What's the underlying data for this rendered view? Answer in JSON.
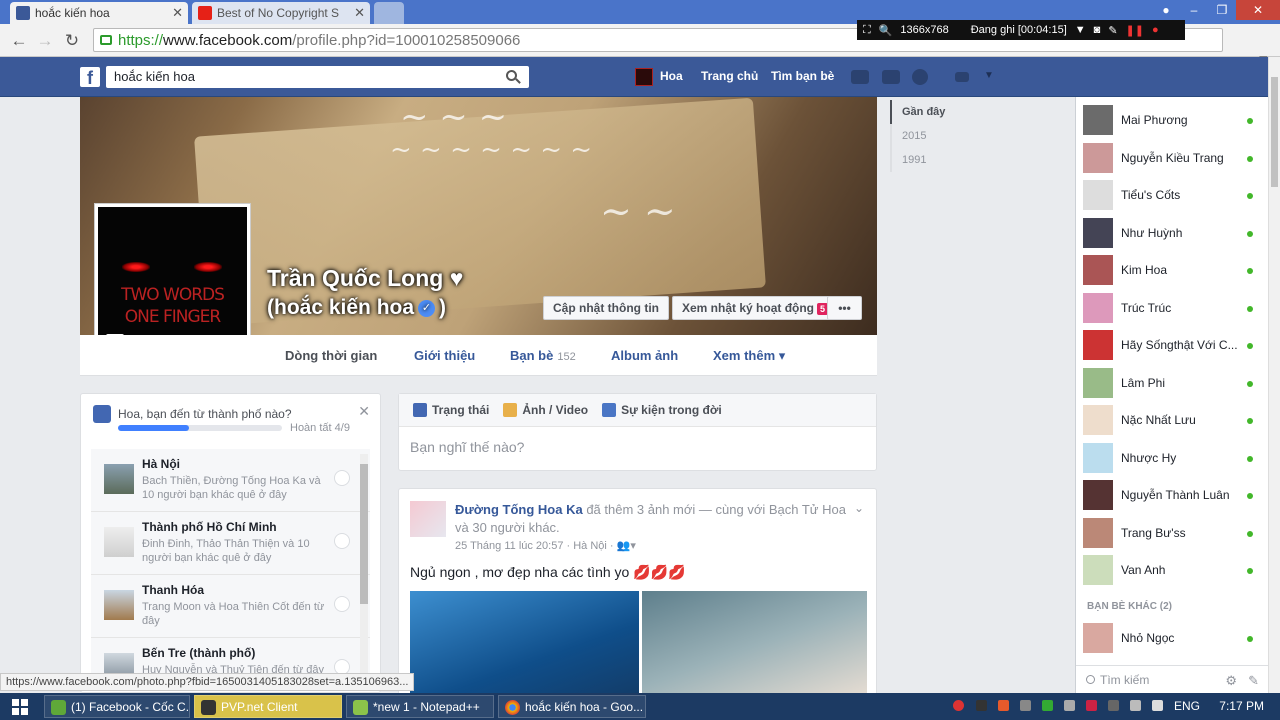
{
  "browser": {
    "tabs": [
      {
        "title": "hoắc kiến hoa",
        "favicon": "facebook-icon",
        "active": true
      },
      {
        "title": "Best of No Copyright S",
        "favicon": "youtube-icon",
        "active": false
      }
    ],
    "url_scheme": "https://",
    "url_host": "www.facebook.com",
    "url_path": "/profile.php?id=100010258509066",
    "recorder": {
      "resolution": "1366x768",
      "status": "Đang ghi [00:04:15]"
    }
  },
  "fb_header": {
    "search_value": "hoắc kiến hoa",
    "user_name": "Hoa",
    "home": "Trang chủ",
    "find_friends": "Tìm bạn bè"
  },
  "profile": {
    "name": "Trần Quốc Long ♥",
    "alt_name": "(hoắc kiến hoa",
    "alt_name_suffix": ")",
    "picture_text_1": "TWO WORDS",
    "picture_text_2": "ONE FINGER",
    "update_info": "Cập nhật thông tin",
    "activity_log": "Xem nhật ký hoạt động",
    "activity_badge": "5",
    "more_dots": "•••"
  },
  "profile_tabs": [
    {
      "label": "Dòng thời gian"
    },
    {
      "label": "Giới thiệu"
    },
    {
      "label": "Bạn bè",
      "count": "152"
    },
    {
      "label": "Album ảnh"
    },
    {
      "label": "Xem thêm ▾"
    }
  ],
  "hometown": {
    "question": "Hoa, bạn đến từ thành phố nào?",
    "progress": 0.43,
    "done": "Hoàn tất 4/9",
    "cities": [
      {
        "name": "Hà Nội",
        "desc": "Bach Thiền, Đường Tống Hoa Ka và 10 người bạn khác quê ở đây"
      },
      {
        "name": "Thành phố Hồ Chí Minh",
        "desc": "Đinh Đinh, Thảo Thản Thiện và 10 người bạn khác quê ở đây"
      },
      {
        "name": "Thanh Hóa",
        "desc": "Trang Moon và Hoa Thiên Cốt đến từ đây"
      },
      {
        "name": "Bến Tre (thành phố)",
        "desc": "Huy Nguyễn và Thuỷ Tiên đến từ đây"
      }
    ]
  },
  "composer": {
    "status": "Trạng thái",
    "photo": "Ảnh / Video",
    "life_event": "Sự kiện trong đời",
    "placeholder": "Bạn nghĩ thế nào?"
  },
  "post": {
    "author": "Đường Tống Hoa Ka",
    "action": "đã thêm 3 ảnh mới — cùng với Bạch Tử Hoa và 30 người khác.",
    "meta": "25 Tháng 11 lúc 20:57 · Hà Nội ·",
    "text": "Ngủ ngon , mơ đẹp nha các tình yo 💋💋💋"
  },
  "years": [
    "Gần đây",
    "2015",
    "1991"
  ],
  "chat": {
    "online": [
      "Mai Phương",
      "Nguyễn Kiều Trang",
      "Tiểu's Cốts",
      "Như Huỳnh",
      "Kim Hoa",
      "Trúc Trúc",
      "Hãy Sốngthật Với C...",
      "Lâm Phi",
      "Nặc Nhất Lưu",
      "Nhược Hy",
      "Nguyễn Thành Luân",
      "Trang Bư'ss",
      "Van Anh"
    ],
    "other_section": "BẠN BÈ KHÁC (2)",
    "other": [
      "Nhỏ Ngọc"
    ],
    "search_placeholder": "Tìm kiếm"
  },
  "status_url": "https://www.facebook.com/photo.php?fbid=1650031405183028set=a.135106963...",
  "taskbar": {
    "items": [
      "(1) Facebook - Cốc C...",
      "PVP.net Client",
      "*new 1 - Notepad++",
      "hoắc kiến hoa - Goo..."
    ],
    "lang": "ENG",
    "time": "7:17 PM"
  },
  "colors": {
    "facebook_blue": "#3b5998",
    "link_blue": "#365899",
    "online_green": "#42b72a"
  }
}
